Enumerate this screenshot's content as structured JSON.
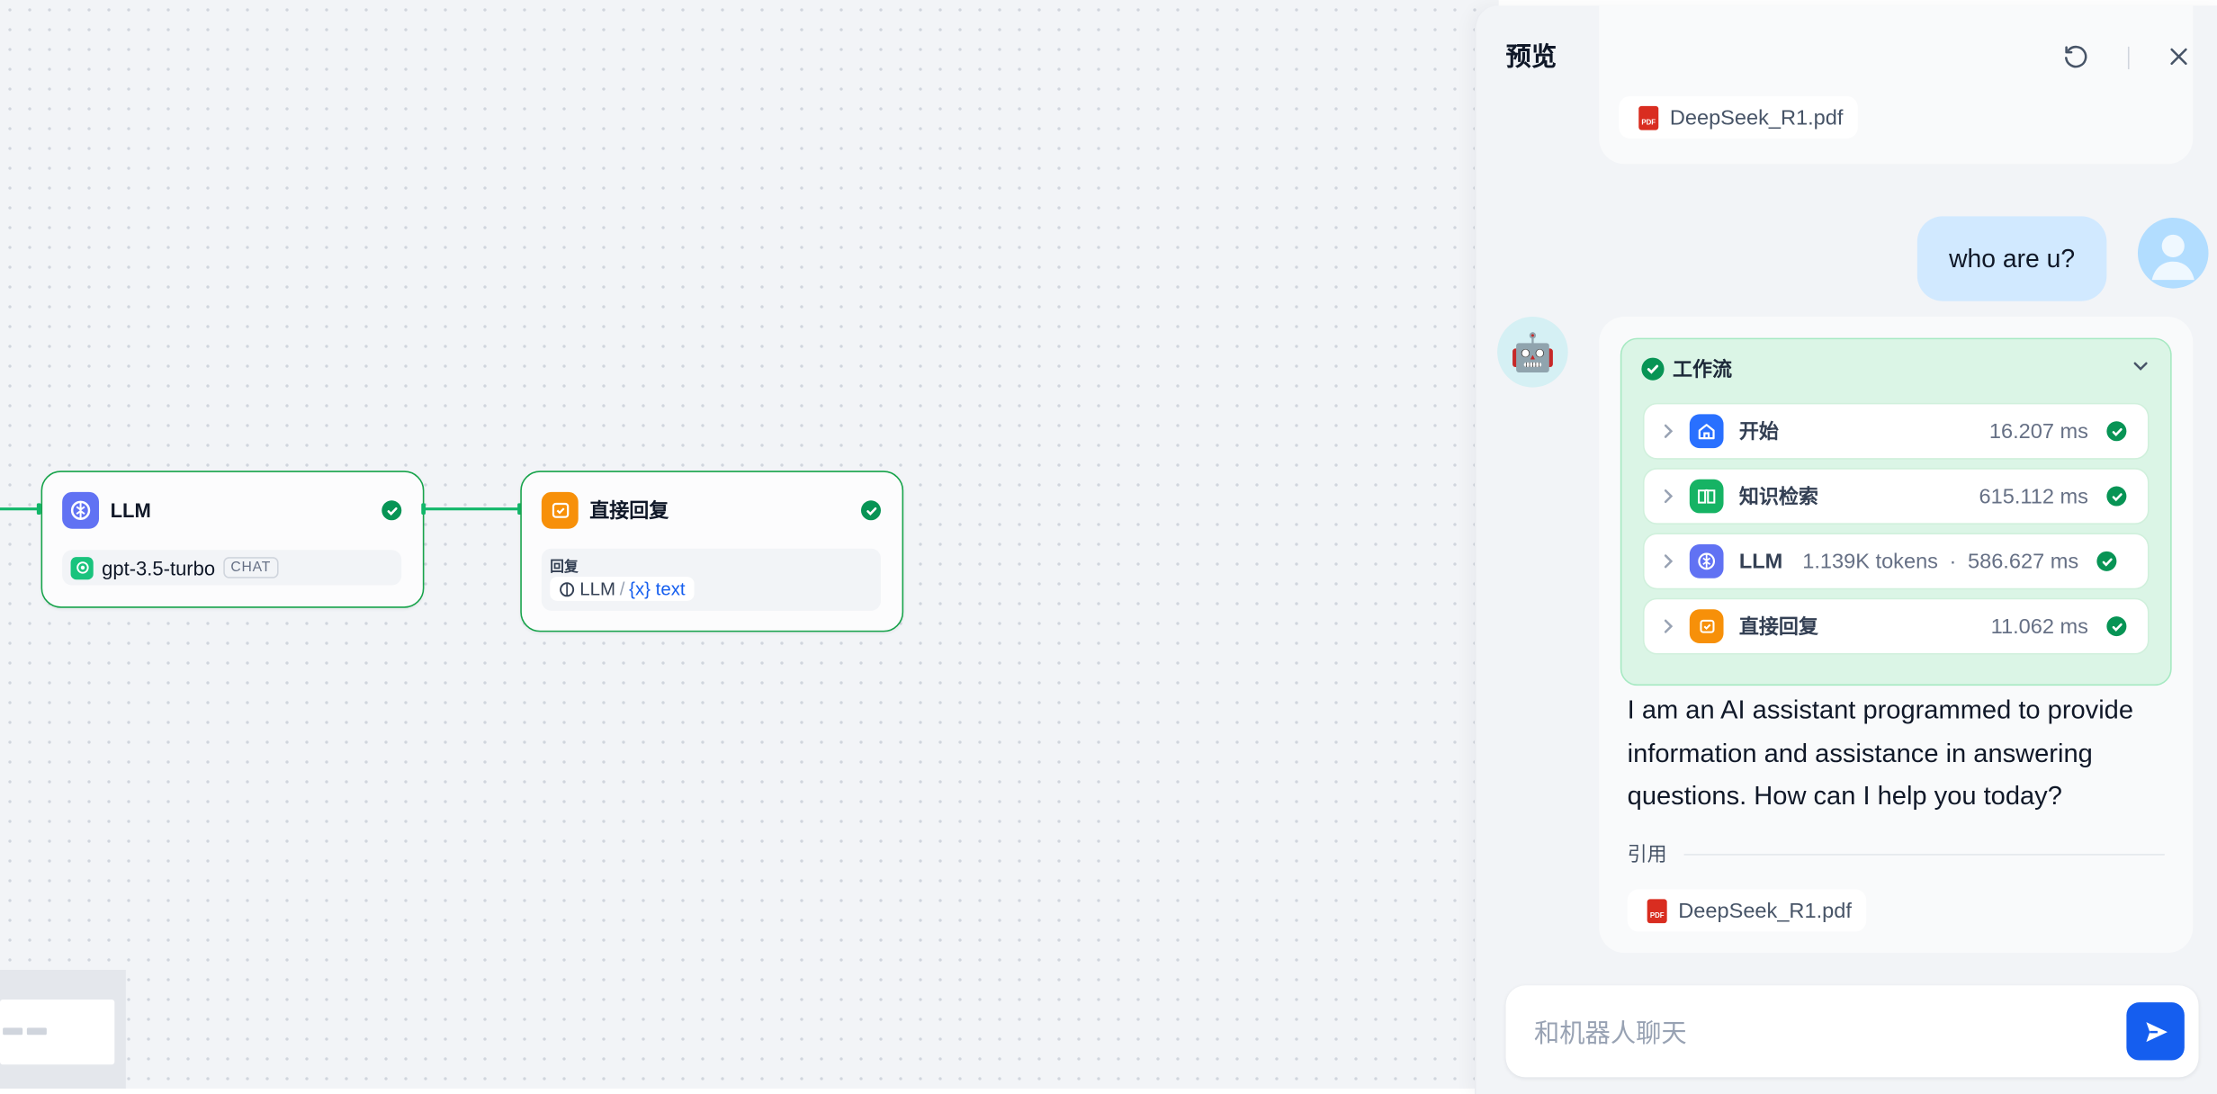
{
  "canvas": {
    "nodes": {
      "llm": {
        "title": "LLM",
        "status": "success",
        "model_name": "gpt-3.5-turbo",
        "model_mode": "CHAT",
        "icon": "brain-icon",
        "icon_color": "#6172F3"
      },
      "answer": {
        "title": "直接回复",
        "status": "success",
        "field_label": "回复",
        "var_source": "LLM",
        "var_separator": "/",
        "var_name": "{x} text",
        "icon": "reply-icon",
        "icon_color": "#F79009"
      }
    },
    "edge_color": "#12B76A"
  },
  "preview": {
    "title": "预览",
    "header_icons": [
      "refresh-icon",
      "close-icon"
    ],
    "messages": {
      "prev_attachment": {
        "file_name": "DeepSeek_R1.pdf",
        "icon": "pdf-icon"
      },
      "user": {
        "text": "who are u?",
        "avatar": "user-avatar"
      },
      "bot": {
        "avatar": "🤖",
        "workflow": {
          "title": "工作流",
          "status": "success",
          "steps": [
            {
              "name": "开始",
              "time": "16.207 ms",
              "icon": "home-icon",
              "color": "#2970FF"
            },
            {
              "name": "知识检索",
              "time": "615.112 ms",
              "icon": "book-icon",
              "color": "#16B364"
            },
            {
              "name": "LLM",
              "tokens": "1.139K tokens",
              "separator": "·",
              "time": "586.627 ms",
              "icon": "brain-icon",
              "color": "#6172F3"
            },
            {
              "name": "直接回复",
              "time": "11.062 ms",
              "icon": "reply-icon",
              "color": "#F79009"
            }
          ]
        },
        "answer_text": "I am an AI assistant programmed to provide information and assistance in answering questions. How can I help you today?",
        "citation_label": "引用",
        "citation_file": "DeepSeek_R1.pdf"
      }
    },
    "input": {
      "placeholder": "和机器人聊天",
      "value": ""
    },
    "send_icon": "send-icon",
    "accent_color": "#155EEF"
  }
}
